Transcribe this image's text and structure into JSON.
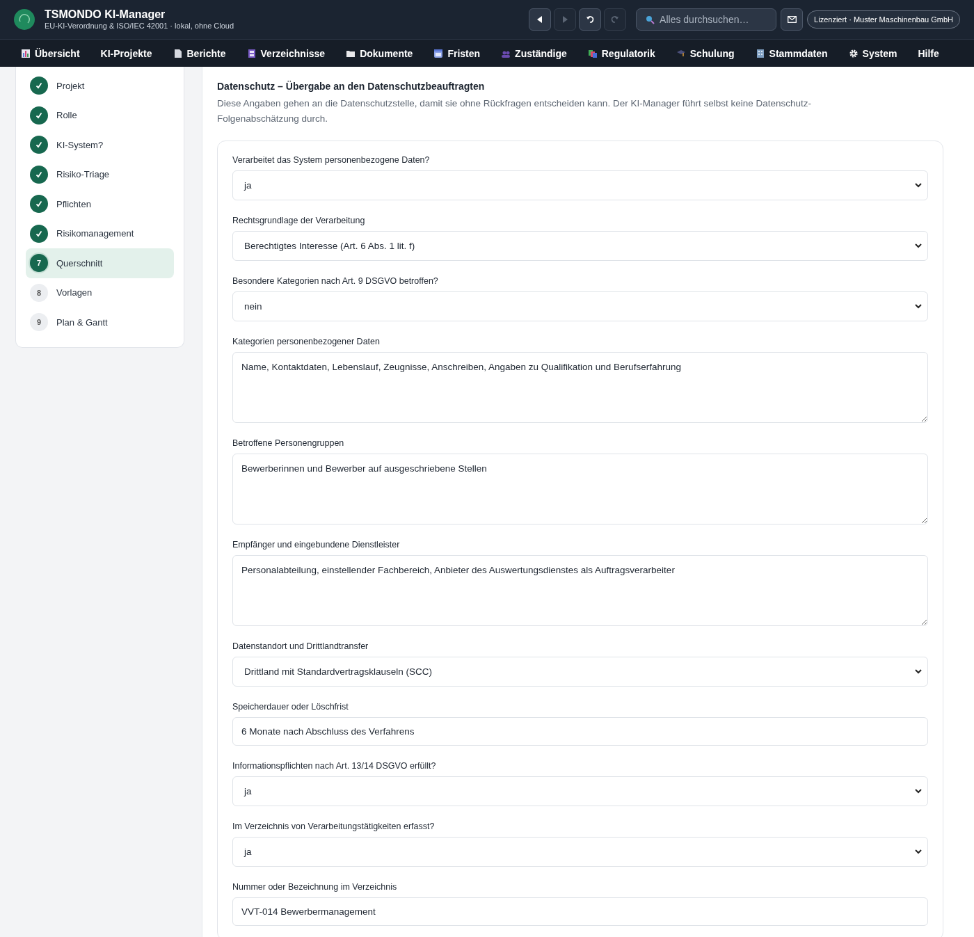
{
  "header": {
    "title": "TSMONDO KI-Manager",
    "subtitle": "EU-KI-Verordnung & ISO/IEC 42001 · lokal, ohne Cloud",
    "history": [
      {
        "kind": "back",
        "disabled": false
      },
      {
        "kind": "forward",
        "disabled": true
      },
      {
        "kind": "undo",
        "disabled": false
      },
      {
        "kind": "redo",
        "disabled": true
      }
    ],
    "search": {
      "placeholder": "Alles durchsuchen…"
    },
    "license": "Lizenziert · Muster Maschinenbau GmbH"
  },
  "nav": [
    {
      "label": "Übersicht",
      "kind": "chart"
    },
    {
      "label": "KI-Projekte",
      "kind": "plain"
    },
    {
      "label": "Berichte",
      "kind": "page"
    },
    {
      "label": "Verzeichnisse",
      "kind": "binder"
    },
    {
      "label": "Dokumente",
      "kind": "folder"
    },
    {
      "label": "Fristen",
      "kind": "calendar"
    },
    {
      "label": "Zuständige",
      "kind": "people"
    },
    {
      "label": "Regulatorik",
      "kind": "books"
    },
    {
      "label": "Schulung",
      "kind": "cap"
    },
    {
      "label": "Stammdaten",
      "kind": "building"
    },
    {
      "label": "System",
      "kind": "gear"
    },
    {
      "label": "Hilfe",
      "kind": "plain"
    }
  ],
  "steps": [
    {
      "label": "Projekt",
      "kind": "done",
      "selected": false
    },
    {
      "label": "Rolle",
      "kind": "done",
      "selected": false
    },
    {
      "label": "KI-System?",
      "kind": "done",
      "selected": false
    },
    {
      "label": "Risiko-Triage",
      "kind": "done",
      "selected": false
    },
    {
      "label": "Pflichten",
      "kind": "done",
      "selected": false
    },
    {
      "label": "Risikomanagement",
      "kind": "done",
      "selected": false
    },
    {
      "number": "7",
      "label": "Querschnitt",
      "kind": "current",
      "selected": true
    },
    {
      "number": "8",
      "label": "Vorlagen",
      "kind": "todo",
      "selected": false
    },
    {
      "number": "9",
      "label": "Plan & Gantt",
      "kind": "todo",
      "selected": false
    }
  ],
  "section": {
    "title": "Datenschutz – Übergabe an den Datenschutzbeauftragten",
    "description": "Diese Angaben gehen an die Datenschutzstelle, damit sie ohne Rückfragen entscheiden kann. Der KI-Manager führt selbst keine Datenschutz-Folgenabschätzung durch.",
    "fields": [
      {
        "kind": "select",
        "label": "Verarbeitet das System personenbezogene Daten?",
        "value": "ja"
      },
      {
        "kind": "select",
        "label": "Rechtsgrundlage der Verarbeitung",
        "value": "Berechtigtes Interesse (Art. 6 Abs. 1 lit. f)"
      },
      {
        "kind": "select",
        "label": "Besondere Kategorien nach Art. 9 DSGVO betroffen?",
        "value": "nein"
      },
      {
        "kind": "textarea",
        "label": "Kategorien personenbezogener Daten",
        "value": "Name, Kontaktdaten, Lebenslauf, Zeugnisse, Anschreiben, Angaben zu Qualifikation und Berufserfahrung"
      },
      {
        "kind": "textarea",
        "label": "Betroffene Personengruppen",
        "value": "Bewerberinnen und Bewerber auf ausgeschriebene Stellen"
      },
      {
        "kind": "textarea",
        "label": "Empfänger und eingebundene Dienstleister",
        "value": "Personalabteilung, einstellender Fachbereich, Anbieter des Auswertungsdienstes als Auftragsverarbeiter"
      },
      {
        "kind": "select",
        "label": "Datenstandort und Drittlandtransfer",
        "value": "Drittland mit Standardvertragsklauseln (SCC)"
      },
      {
        "kind": "input",
        "label": "Speicherdauer oder Löschfrist",
        "value": "6 Monate nach Abschluss des Verfahrens"
      },
      {
        "kind": "select",
        "label": "Informationspflichten nach Art. 13/14 DSGVO erfüllt?",
        "value": "ja"
      },
      {
        "kind": "select",
        "label": "Im Verzeichnis von Verarbeitungstätigkeiten erfasst?",
        "value": "ja"
      },
      {
        "kind": "input",
        "label": "Nummer oder Bezeichnung im Verzeichnis",
        "value": "VVT-014 Bewerbermanagement"
      }
    ]
  }
}
